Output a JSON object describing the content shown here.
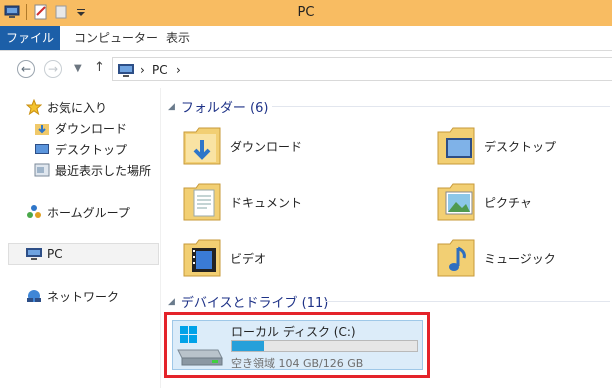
{
  "window": {
    "title": "PC"
  },
  "ribbon": {
    "tabs": [
      "ファイル",
      "コンピューター",
      "表示"
    ]
  },
  "address": {
    "path": [
      "PC"
    ],
    "separator": "›"
  },
  "nav_pane": {
    "favorites": {
      "label": "お気に入り",
      "items": [
        "ダウンロード",
        "デスクトップ",
        "最近表示した場所"
      ]
    },
    "homegroup": "ホームグループ",
    "pc": "PC",
    "network": "ネットワーク"
  },
  "content": {
    "folders_group": {
      "title": "フォルダー (6)",
      "items": [
        {
          "label": "ダウンロード",
          "icon": "download-folder-icon"
        },
        {
          "label": "デスクトップ",
          "icon": "desktop-folder-icon"
        },
        {
          "label": "ドキュメント",
          "icon": "documents-folder-icon"
        },
        {
          "label": "ピクチャ",
          "icon": "pictures-folder-icon"
        },
        {
          "label": "ビデオ",
          "icon": "videos-folder-icon"
        },
        {
          "label": "ミュージック",
          "icon": "music-folder-icon"
        }
      ]
    },
    "drives_group": {
      "title": "デバイスとドライブ (11)",
      "drive": {
        "name": "ローカル ディスク (C:)",
        "space_text": "空き領域 104 GB/126 GB",
        "used_fraction": 0.175
      }
    }
  },
  "colors": {
    "titlebar": "#f8bc62",
    "file_tab": "#1c5fa8",
    "group_header": "#1e3287",
    "highlight": "#e4232a",
    "drive_bar_fill": "#26a0da"
  }
}
